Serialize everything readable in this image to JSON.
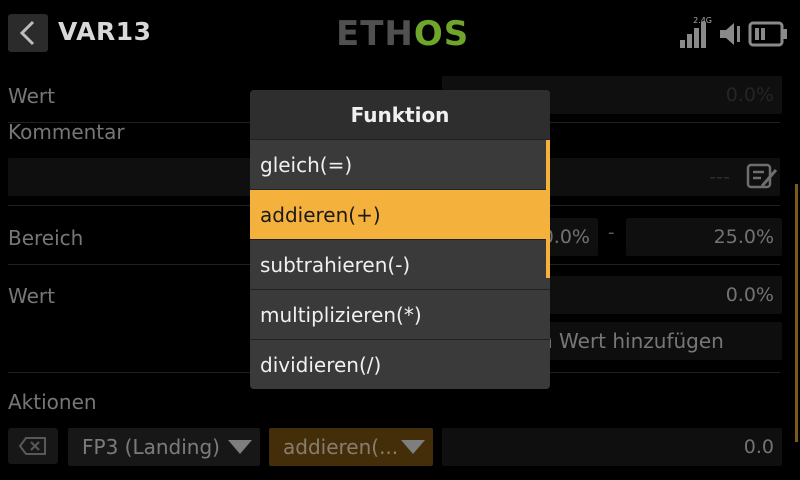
{
  "header": {
    "title": "VAR13",
    "logo_left": "ETH",
    "logo_right": "OS",
    "signal_label": "2.4G"
  },
  "form": {
    "wert_label": "Wert",
    "wert_value": "0.0%",
    "kommentar_label": "Kommentar",
    "kommentar_value": "---",
    "bereich_label": "Bereich",
    "bereich_min": "0.0%",
    "bereich_sep": "-",
    "bereich_max": "25.0%",
    "wert2_label": "Wert",
    "wert2_value": "0.0%",
    "add_value_button": "n Wert hinzufügen",
    "aktionen_label": "Aktionen"
  },
  "actions_row": {
    "source_dropdown": "FP3 (Landing)",
    "function_dropdown": "addieren(...",
    "value": "0.0"
  },
  "modal": {
    "title": "Funktion",
    "options": [
      {
        "label": "gleich(=)"
      },
      {
        "label": "addieren(+)"
      },
      {
        "label": "subtrahieren(-)"
      },
      {
        "label": "multiplizieren(*)"
      },
      {
        "label": "dividieren(/)"
      }
    ],
    "selected_index": 1
  },
  "colors": {
    "accent": "#f4b13c",
    "logo_green": "#6fa52b"
  }
}
